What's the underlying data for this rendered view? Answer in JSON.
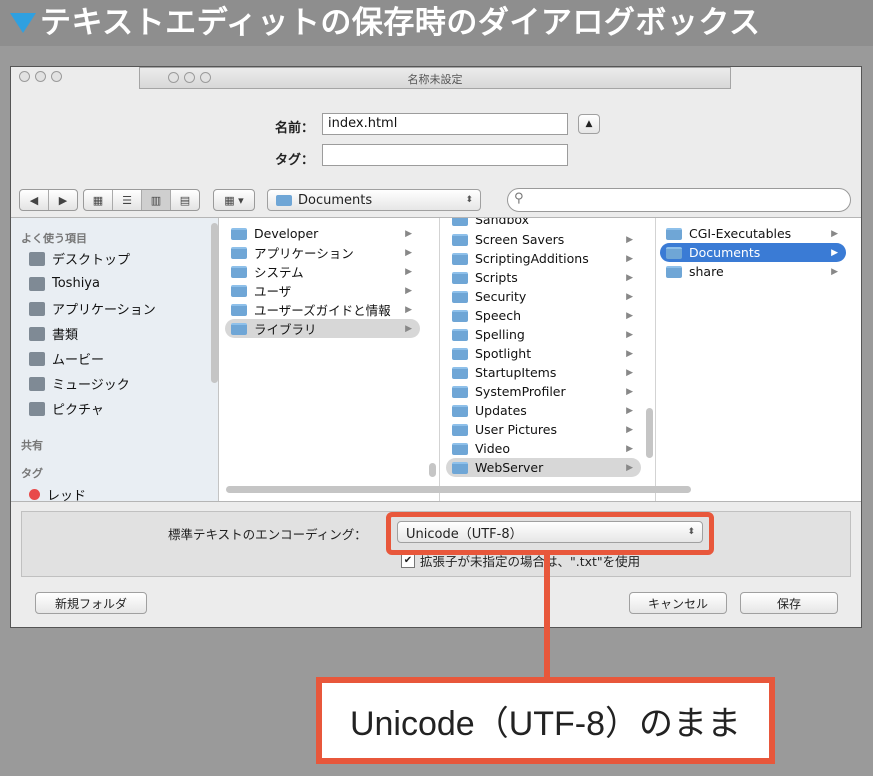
{
  "heading": "テキストエディットの保存時のダイアログボックス",
  "window": {
    "title": "名称未設定"
  },
  "form": {
    "name_label": "名前：",
    "name_value": "index.html",
    "tag_label": "タグ：",
    "tag_value": ""
  },
  "toolbar": {
    "location": "Documents",
    "search_placeholder": ""
  },
  "sidebar": {
    "favorites_header": "よく使う項目",
    "favorites": [
      {
        "label": "デスクトップ",
        "icon": "desktop-icon"
      },
      {
        "label": "Toshiya",
        "icon": "home-icon"
      },
      {
        "label": "アプリケーション",
        "icon": "applications-icon"
      },
      {
        "label": "書類",
        "icon": "documents-icon"
      },
      {
        "label": "ムービー",
        "icon": "movies-icon"
      },
      {
        "label": "ミュージック",
        "icon": "music-icon"
      },
      {
        "label": "ピクチャ",
        "icon": "pictures-icon"
      }
    ],
    "shared_header": "共有",
    "tags_header": "タグ",
    "tag_item": "レッド"
  },
  "columns": {
    "col1": [
      "Developer",
      "アプリケーション",
      "システム",
      "ユーザ",
      "ユーザーズガイドと情報",
      "ライブラリ"
    ],
    "col2_partial": "Sandbox",
    "col2": [
      "Screen Savers",
      "ScriptingAdditions",
      "Scripts",
      "Security",
      "Speech",
      "Spelling",
      "Spotlight",
      "StartupItems",
      "SystemProfiler",
      "Updates",
      "User Pictures",
      "Video",
      "WebServer"
    ],
    "col3": [
      "CGI-Executables",
      "Documents",
      "share"
    ]
  },
  "encoding": {
    "label": "標準テキストのエンコーディング：",
    "value": "Unicode（UTF-8）",
    "checkbox_label": "拡張子が未指定の場合は、\".txt\"を使用"
  },
  "buttons": {
    "new_folder": "新規フォルダ",
    "cancel": "キャンセル",
    "save": "保存"
  },
  "callout": "Unicode（UTF-8）のまま",
  "colors": {
    "accent": "#e8573b",
    "selection": "#3a7bd5",
    "heading_triangle": "#2fa0e0"
  }
}
